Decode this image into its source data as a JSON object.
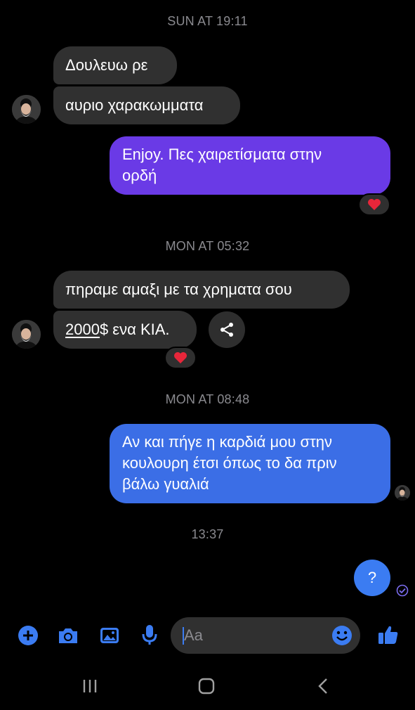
{
  "timestamps": {
    "t1": "SUN AT 19:11",
    "t2": "MON AT 05:32",
    "t3": "MON AT 08:48",
    "t4": "13:37"
  },
  "messages": {
    "m1": "Δουλευω ρε",
    "m2": "αυριο χαρακωμματα",
    "m3_line1": "Enjoy. Πες χαιρετίσματα στην",
    "m3_line2": "ορδή",
    "m4": "πηραμε αμαξι με τα χρηματα σου",
    "m5_amount": "2000",
    "m5_rest": "$ ενα KIA.",
    "m6_line1": "Αν και πήγε η καρδιά μου στην",
    "m6_line2": "κουλουρη έτσι όπως το δα πριν",
    "m6_line3": "βάλω γυαλιά",
    "m7": "?"
  },
  "reactions": {
    "heart": "❤️"
  },
  "composer": {
    "placeholder": "Aa"
  },
  "colors": {
    "accent": "#3b7cf2",
    "incoming_bubble": "#303030",
    "outgoing_purple": "#6a3ae6",
    "outgoing_blue": "#3b6ee6",
    "timestamp": "#8a8a8f"
  },
  "icons": [
    "plus-icon",
    "camera-icon",
    "image-icon",
    "mic-icon",
    "emoji-icon",
    "like-icon",
    "share-icon",
    "seen-check-icon",
    "recents-icon",
    "home-icon",
    "back-icon"
  ]
}
